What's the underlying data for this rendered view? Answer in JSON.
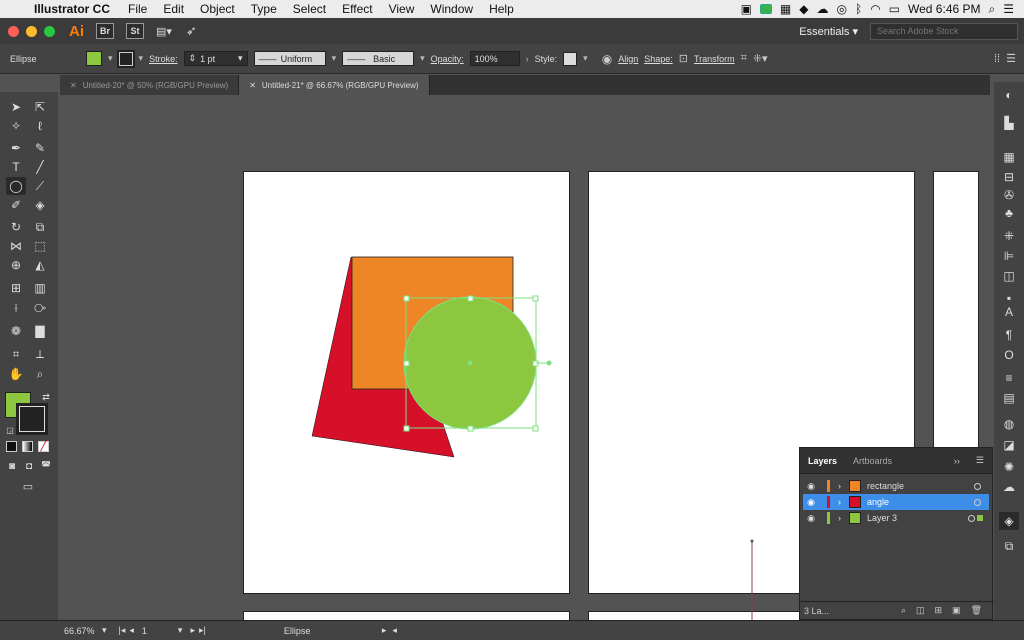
{
  "menubar": {
    "app_name": "Illustrator CC",
    "menus": [
      "File",
      "Edit",
      "Object",
      "Type",
      "Select",
      "Effect",
      "View",
      "Window",
      "Help"
    ],
    "clock": "Wed 6:46 PM"
  },
  "appbar": {
    "logo": "Ai",
    "bridge": "Br",
    "stock": "St",
    "workspace": "Essentials",
    "search_placeholder": "Search Adobe Stock"
  },
  "control_bar": {
    "selection_type": "Ellipse",
    "stroke_label": "Stroke:",
    "stroke_weight": "1 pt",
    "profile": "Uniform",
    "brush": "Basic",
    "opacity_label": "Opacity:",
    "opacity_value": "100%",
    "style_label": "Style:",
    "align_label": "Align",
    "shape_label": "Shape:",
    "transform_label": "Transform",
    "fill_color": "#8dc63f"
  },
  "tabs": [
    {
      "label": "Untitled-20* @ 50% (RGB/GPU Preview)",
      "active": false
    },
    {
      "label": "Untitled-21* @ 66.67% (RGB/GPU Preview)",
      "active": true
    }
  ],
  "artwork": {
    "rectangle_color": "#ee8627",
    "triangle_color": "#d7102a",
    "ellipse_color": "#8dc63f",
    "selection_color": "#7ee07e"
  },
  "layers_panel": {
    "tab_layers": "Layers",
    "tab_artboards": "Artboards",
    "layers": [
      {
        "name": "rectangle",
        "color": "#ee8627",
        "selected": false
      },
      {
        "name": "angle",
        "color": "#d7102a",
        "selected": true
      },
      {
        "name": "Layer 3",
        "color": "#8dc63f",
        "selected": false
      }
    ],
    "footer_count": "3 La..."
  },
  "status_bar": {
    "zoom": "66.67%",
    "artboard_number": "1",
    "current_tool": "Ellipse"
  }
}
